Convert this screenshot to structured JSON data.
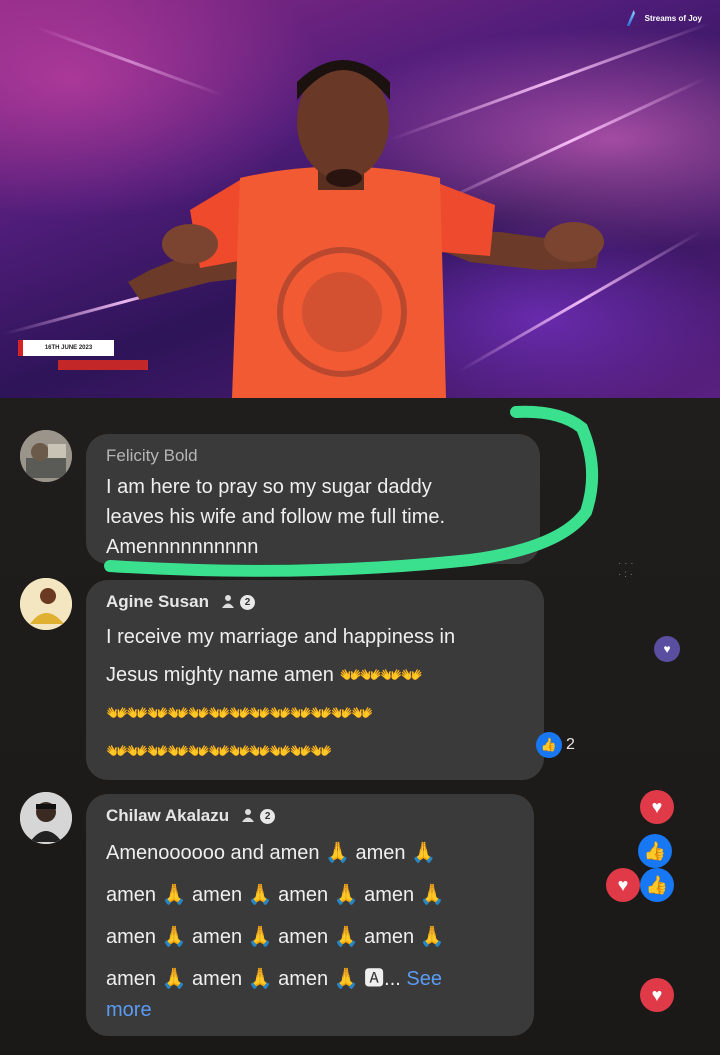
{
  "video": {
    "channel_logo": "Streams of Joy",
    "date_label": "16TH JUNE 2023"
  },
  "comments": [
    {
      "author": "Felicity Bold",
      "lines": [
        "I am here to pray so my sugar daddy",
        "leaves his wife and follow me full time.",
        "Amennnnnnnnnn"
      ],
      "top_fan": false
    },
    {
      "author": "Agine Susan",
      "badge": "2",
      "top_fan": true,
      "line1": "I receive my marriage and happiness in",
      "line2": "Jesus mighty name amen",
      "hands_line2": "👐👐👐👐",
      "hands_line3": "👐👐👐👐👐👐👐👐👐👐👐👐👐",
      "hands_line4": "👐👐👐👐👐👐👐👐👐👐👐",
      "reaction_count": "2"
    },
    {
      "author": "Chilaw Akalazu",
      "badge": "2",
      "top_fan": true,
      "line1": "Amenoooooo and amen 🙏 amen 🙏",
      "line2": "amen 🙏 amen 🙏 amen 🙏 amen 🙏",
      "line3": "amen 🙏 amen 🙏 amen 🙏 amen 🙏",
      "line4": "amen 🙏 amen 🙏 amen 🙏 🅰...",
      "see_label": "See",
      "more_label": "more"
    }
  ],
  "icons": {
    "like": "like-icon",
    "heart": "heart-icon",
    "fan": "top-fan-icon"
  },
  "colors": {
    "highlight": "#3be08f",
    "like": "#1877f2",
    "heart": "#e03a49",
    "bubble": "#3a3a3a"
  }
}
